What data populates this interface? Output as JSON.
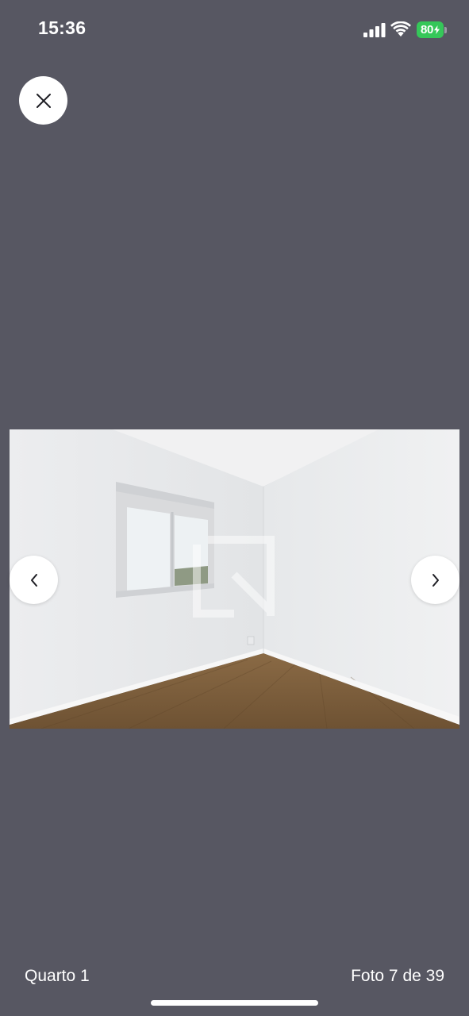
{
  "status_bar": {
    "time": "15:36",
    "battery_level": "80",
    "battery_charging": true,
    "signal_icon": "cellular-signal-icon",
    "wifi_icon": "wifi-icon",
    "battery_color": "#35c759"
  },
  "viewer": {
    "close_icon": "close-icon",
    "prev_icon": "chevron-left-icon",
    "next_icon": "chevron-right-icon",
    "photo_subject": "empty bedroom with window and wood floor",
    "watermark_icon": "brand-logo-watermark"
  },
  "footer": {
    "caption": "Quarto 1",
    "counter": "Foto 7 de 39"
  },
  "colors": {
    "background": "#575762",
    "button_bg": "#ffffff",
    "text": "#ffffff"
  }
}
